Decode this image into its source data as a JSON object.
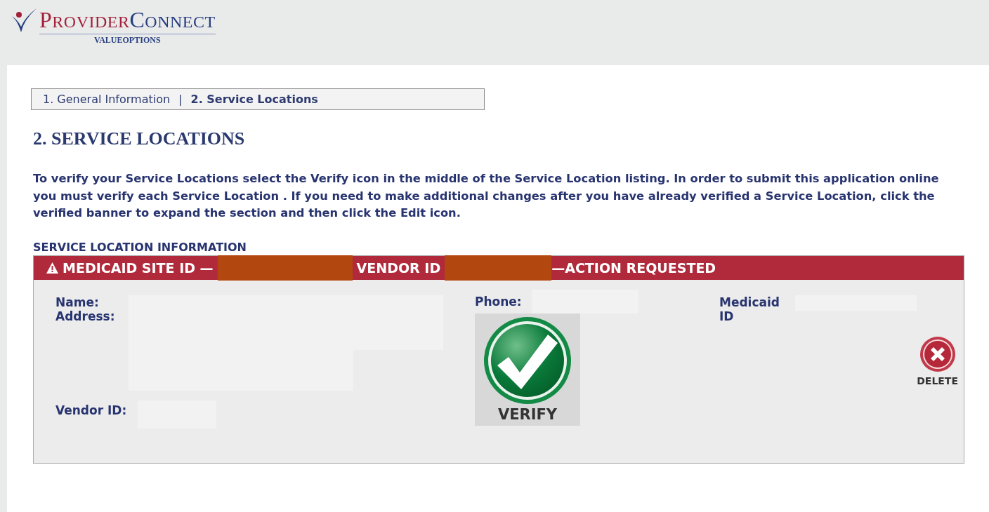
{
  "logo": {
    "word_1": "PROVIDER",
    "word_2": "CONNECT",
    "tagline": "VALUEOPTIONS"
  },
  "tabs": [
    {
      "label": "1. General Information",
      "selected": false
    },
    {
      "label": "2. Service Locations",
      "selected": true
    }
  ],
  "tab_separator": "|",
  "heading": "2. SERVICE LOCATIONS",
  "instructions": "To verify your Service Locations select the Verify icon in the middle of the Service Location listing. In order to submit this application online you must verify each Service Location . If you need to make additional changes after you have already verified a Service Location, click the verified banner to expand the section and then click the Edit icon.",
  "section_title": "SERVICE LOCATION INFORMATION",
  "location": {
    "site_label": "MEDICAID SITE ID —",
    "vendor_label": "VENDOR ID",
    "status": "—ACTION REQUESTED",
    "name_label": "Name:",
    "address_label": "Address:",
    "vendor_id_label": "Vendor ID:",
    "phone_label": "Phone:",
    "medicaid_label": "Medicaid ID",
    "verify": "VERIFY",
    "delete": "DELETE"
  }
}
